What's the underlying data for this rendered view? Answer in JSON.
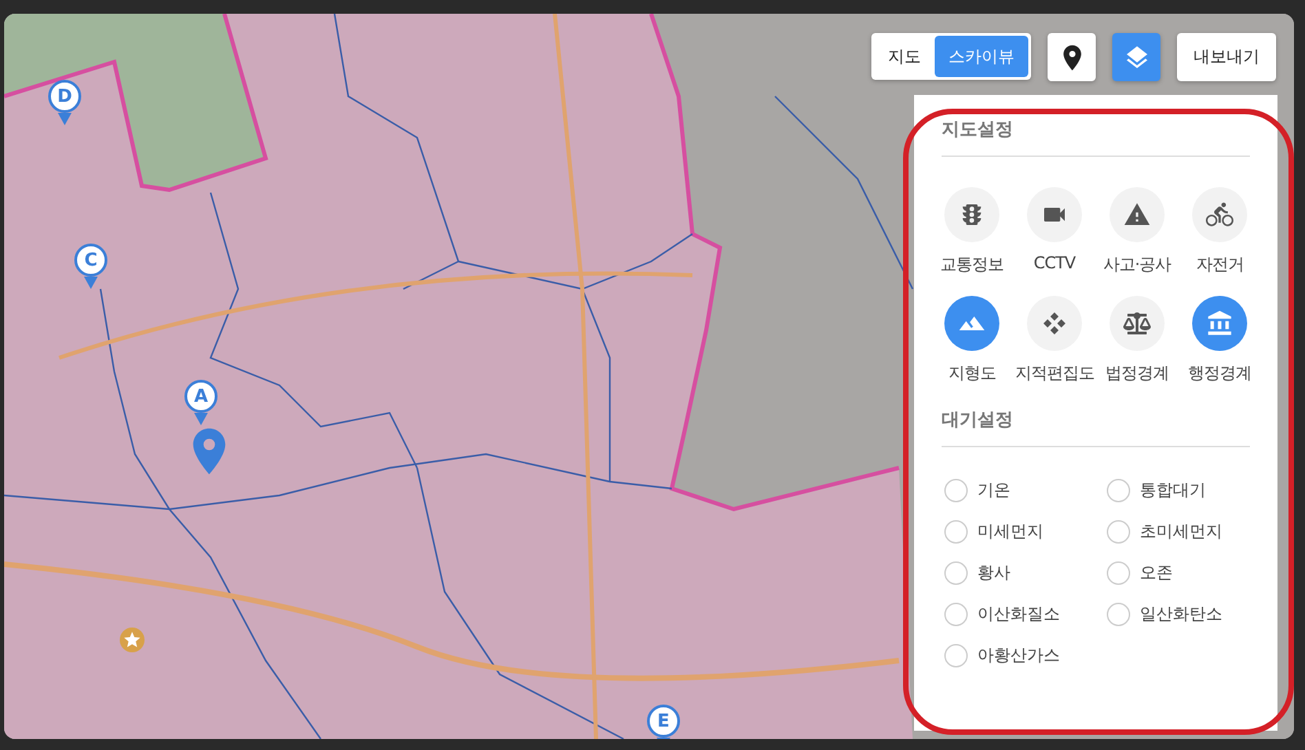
{
  "map_type_toggle": [
    {
      "label": "지도",
      "selected": false
    },
    {
      "label": "스카이뷰",
      "selected": true
    }
  ],
  "layers_button": {
    "selected": true
  },
  "export_button": "내보내기",
  "map_settings": {
    "title": "지도설정",
    "items": [
      {
        "label": "교통정보",
        "selected": false
      },
      {
        "label": "CCTV",
        "selected": false
      },
      {
        "label": "사고·공사",
        "selected": false
      },
      {
        "label": "자전거",
        "selected": false
      },
      {
        "label": "지형도",
        "selected": true
      },
      {
        "label": "지적편집도",
        "selected": false
      },
      {
        "label": "법정경계",
        "selected": false
      },
      {
        "label": "행정경계",
        "selected": true
      }
    ]
  },
  "air_settings": {
    "title": "대기설정",
    "options": [
      {
        "label": "기온",
        "selected": false
      },
      {
        "label": "통합대기",
        "selected": false
      },
      {
        "label": "미세먼지",
        "selected": false
      },
      {
        "label": "초미세먼지",
        "selected": false
      },
      {
        "label": "황사",
        "selected": false
      },
      {
        "label": "오존",
        "selected": false
      },
      {
        "label": "이산화질소",
        "selected": false
      },
      {
        "label": "일산화탄소",
        "selected": false
      },
      {
        "label": "아황산가스",
        "selected": false
      }
    ]
  },
  "map_markers": [
    {
      "label": "A"
    },
    {
      "label": "C"
    },
    {
      "label": "D"
    },
    {
      "label": "E"
    }
  ]
}
